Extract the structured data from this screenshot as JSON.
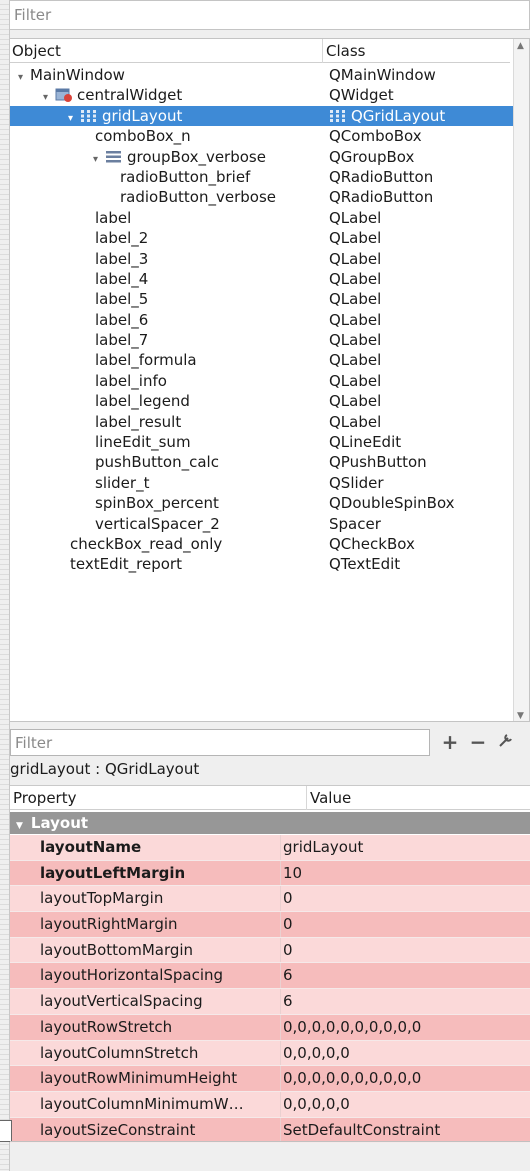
{
  "object_inspector": {
    "filter_placeholder": "Filter",
    "header_object": "Object",
    "header_class": "Class",
    "rows": [
      {
        "name": "MainWindow",
        "class": "QMainWindow",
        "arrow": "▾",
        "icon": "",
        "depth": 0,
        "selected": false
      },
      {
        "name": "centralWidget",
        "class": "QWidget",
        "arrow": "▾",
        "icon": "widget-icon",
        "depth": 1,
        "selected": false
      },
      {
        "name": "gridLayout",
        "class": "QGridLayout",
        "arrow": "▾",
        "icon": "grid-layout-icon",
        "depth": 2,
        "selected": true
      },
      {
        "name": "comboBox_n",
        "class": "QComboBox",
        "arrow": "",
        "icon": "",
        "depth": 3,
        "selected": false
      },
      {
        "name": "groupBox_verbose",
        "class": "QGroupBox",
        "arrow": "▾",
        "icon": "vbox-layout-icon",
        "depth": 3,
        "selected": false
      },
      {
        "name": "radioButton_brief",
        "class": "QRadioButton",
        "arrow": "",
        "icon": "",
        "depth": 4,
        "selected": false
      },
      {
        "name": "radioButton_verbose",
        "class": "QRadioButton",
        "arrow": "",
        "icon": "",
        "depth": 4,
        "selected": false
      },
      {
        "name": "label",
        "class": "QLabel",
        "arrow": "",
        "icon": "",
        "depth": 3,
        "selected": false
      },
      {
        "name": "label_2",
        "class": "QLabel",
        "arrow": "",
        "icon": "",
        "depth": 3,
        "selected": false
      },
      {
        "name": "label_3",
        "class": "QLabel",
        "arrow": "",
        "icon": "",
        "depth": 3,
        "selected": false
      },
      {
        "name": "label_4",
        "class": "QLabel",
        "arrow": "",
        "icon": "",
        "depth": 3,
        "selected": false
      },
      {
        "name": "label_5",
        "class": "QLabel",
        "arrow": "",
        "icon": "",
        "depth": 3,
        "selected": false
      },
      {
        "name": "label_6",
        "class": "QLabel",
        "arrow": "",
        "icon": "",
        "depth": 3,
        "selected": false
      },
      {
        "name": "label_7",
        "class": "QLabel",
        "arrow": "",
        "icon": "",
        "depth": 3,
        "selected": false
      },
      {
        "name": "label_formula",
        "class": "QLabel",
        "arrow": "",
        "icon": "",
        "depth": 3,
        "selected": false
      },
      {
        "name": "label_info",
        "class": "QLabel",
        "arrow": "",
        "icon": "",
        "depth": 3,
        "selected": false
      },
      {
        "name": "label_legend",
        "class": "QLabel",
        "arrow": "",
        "icon": "",
        "depth": 3,
        "selected": false
      },
      {
        "name": "label_result",
        "class": "QLabel",
        "arrow": "",
        "icon": "",
        "depth": 3,
        "selected": false
      },
      {
        "name": "lineEdit_sum",
        "class": "QLineEdit",
        "arrow": "",
        "icon": "",
        "depth": 3,
        "selected": false
      },
      {
        "name": "pushButton_calc",
        "class": "QPushButton",
        "arrow": "",
        "icon": "",
        "depth": 3,
        "selected": false
      },
      {
        "name": "slider_t",
        "class": "QSlider",
        "arrow": "",
        "icon": "",
        "depth": 3,
        "selected": false
      },
      {
        "name": "spinBox_percent",
        "class": "QDoubleSpinBox",
        "arrow": "",
        "icon": "",
        "depth": 3,
        "selected": false
      },
      {
        "name": "verticalSpacer_2",
        "class": "Spacer",
        "arrow": "",
        "icon": "",
        "depth": 3,
        "selected": false
      },
      {
        "name": "checkBox_read_only",
        "class": "QCheckBox",
        "arrow": "",
        "icon": "",
        "depth": 2,
        "selected": false
      },
      {
        "name": "textEdit_report",
        "class": "QTextEdit",
        "arrow": "",
        "icon": "",
        "depth": 2,
        "selected": false
      }
    ]
  },
  "property_editor": {
    "filter_placeholder": "Filter",
    "add_icon": "plus-icon",
    "remove_icon": "minus-icon",
    "configure_icon": "wrench-icon",
    "object_class_label": "gridLayout : QGridLayout",
    "header_property": "Property",
    "header_value": "Value",
    "group_label": "Layout",
    "properties": [
      {
        "name": "layoutName",
        "value": "gridLayout",
        "bold": true
      },
      {
        "name": "layoutLeftMargin",
        "value": "10",
        "bold": true
      },
      {
        "name": "layoutTopMargin",
        "value": "0",
        "bold": false
      },
      {
        "name": "layoutRightMargin",
        "value": "0",
        "bold": false
      },
      {
        "name": "layoutBottomMargin",
        "value": "0",
        "bold": false
      },
      {
        "name": "layoutHorizontalSpacing",
        "value": "6",
        "bold": false
      },
      {
        "name": "layoutVerticalSpacing",
        "value": "6",
        "bold": false
      },
      {
        "name": "layoutRowStretch",
        "value": "0,0,0,0,0,0,0,0,0,0",
        "bold": false
      },
      {
        "name": "layoutColumnStretch",
        "value": "0,0,0,0,0",
        "bold": false
      },
      {
        "name": "layoutRowMinimumHeight",
        "value": "0,0,0,0,0,0,0,0,0,0",
        "bold": false
      },
      {
        "name": "layoutColumnMinimumW…",
        "value": "0,0,0,0,0",
        "bold": false
      },
      {
        "name": "layoutSizeConstraint",
        "value": "SetDefaultConstraint",
        "bold": false
      }
    ]
  },
  "colors": {
    "selection": "#3e8ad6",
    "group_header": "#979797",
    "row_light": "#fbd9d9",
    "row_dark": "#f6bcbc"
  }
}
